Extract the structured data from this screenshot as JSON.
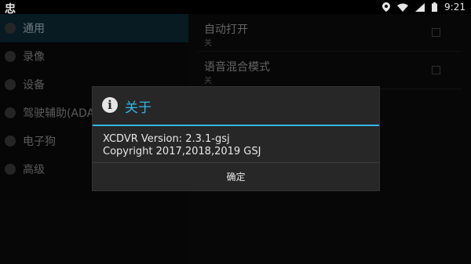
{
  "statusbar": {
    "app_icon": "忠",
    "time": "9:21",
    "icons": [
      "location-icon",
      "wifi-icon",
      "signal-icon",
      "battery-icon"
    ]
  },
  "sidebar": {
    "items": [
      {
        "label": "通用",
        "icon": "info-icon",
        "selected": true
      },
      {
        "label": "录像",
        "icon": "camera-icon",
        "selected": false
      },
      {
        "label": "设备",
        "icon": "device-icon",
        "selected": false
      },
      {
        "label": "驾驶辅助(ADAS",
        "icon": "drive-icon",
        "selected": false
      },
      {
        "label": "电子狗",
        "icon": "alert-icon",
        "selected": false
      },
      {
        "label": "高级",
        "icon": "advanced-icon",
        "selected": false
      }
    ]
  },
  "settings": [
    {
      "title": "自动打开",
      "summary": "关"
    },
    {
      "title": "语音混合模式",
      "summary": "关"
    }
  ],
  "dialog": {
    "title": "关于",
    "icon": "info-icon",
    "lines": [
      "XCDVR Version: 2.3.1-gsj",
      "Copyright 2017,2018,2019 GSJ"
    ],
    "ok_label": "确定"
  },
  "colors": {
    "accent": "#33b5e5",
    "dialog_bg": "#272727",
    "selected_bg": "#0d2a36"
  }
}
